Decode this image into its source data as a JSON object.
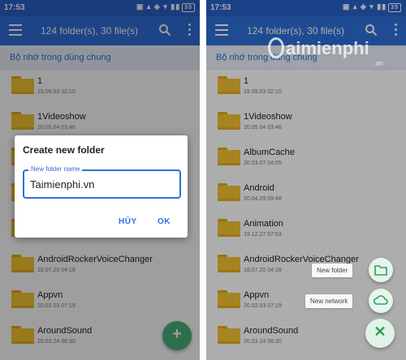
{
  "status_bar": {
    "time": "17:53",
    "icons": "▣ ▴ ◈ ▾ ▮▮",
    "battery": "35"
  },
  "app_bar": {
    "title": "124 folder(s), 30 file(s)"
  },
  "path": "Bộ nhớ trong dùng chung",
  "left_list": [
    {
      "name": "1",
      "date": "19.09.03 02:10"
    },
    {
      "name": "1Videoshow",
      "date": "20.05.04 03:46"
    },
    {
      "name": "",
      "date": ""
    },
    {
      "name": "",
      "date": ""
    },
    {
      "name": "",
      "date": ""
    },
    {
      "name": "AndroidRockerVoiceChanger",
      "date": "18.07.20 04:18"
    },
    {
      "name": "Appvn",
      "date": "20.02.03 07:19"
    },
    {
      "name": "AroundSound",
      "date": "20.03.24 06:30"
    }
  ],
  "right_list": [
    {
      "name": "1",
      "date": "19.09.03 02:10"
    },
    {
      "name": "1Videoshow",
      "date": "20.05.04 03:46"
    },
    {
      "name": "AlbumCache",
      "date": "20.03.07 04:05"
    },
    {
      "name": "Android",
      "date": "20.04.29 09:48"
    },
    {
      "name": "Animation",
      "date": "19.12.27 07:53"
    },
    {
      "name": "AndroidRockerVoiceChanger",
      "date": "18.07.20 04:18"
    },
    {
      "name": "Appvn",
      "date": "20.02.03 07:19"
    },
    {
      "name": "AroundSound",
      "date": "20.03.24 06:30"
    }
  ],
  "dialog": {
    "title": "Create new folder",
    "field_label": "New folder name",
    "field_value": "Taimienphi.vn",
    "cancel_label": "HỦY",
    "ok_label": "OK"
  },
  "fab_menu": {
    "new_folder_label": "New folder",
    "new_network_label": "New network"
  },
  "watermark": {
    "brand": "aimienphi",
    "sub": ".vn"
  },
  "colors": {
    "primary": "#2f6fd8",
    "status": "#2962c9",
    "fab": "#4ab37c",
    "folder": "#f4c331"
  }
}
